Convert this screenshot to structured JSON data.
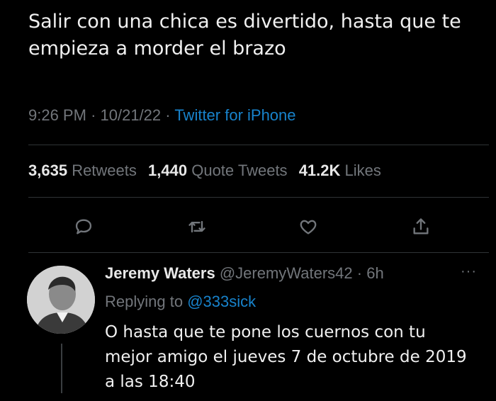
{
  "caption": "Salir con una chica es divertido, hasta que te empieza a morder el brazo",
  "tweet": {
    "time": "9:26 PM",
    "date": "10/21/22",
    "source": "Twitter for iPhone",
    "separator": "·",
    "stats": {
      "retweets_count": "3,635",
      "retweets_label": "Retweets",
      "quotes_count": "1,440",
      "quotes_label": "Quote Tweets",
      "likes_count": "41.2K",
      "likes_label": "Likes"
    }
  },
  "actions": {
    "reply_icon": "reply-icon",
    "retweet_icon": "retweet-icon",
    "like_icon": "heart-icon",
    "share_icon": "share-icon",
    "icon_color": "#72767b"
  },
  "reply": {
    "display_name": "Jeremy Waters",
    "handle": "@JeremyWaters42",
    "age": "6h",
    "more": "···",
    "replying_label": "Replying to",
    "replying_handle": "@333sick",
    "text": "O hasta que te pone los cuernos con tu mejor amigo el jueves 7 de octubre de 2019 a las 18:40"
  },
  "colors": {
    "background": "#000000",
    "text": "#f0f0f0",
    "muted": "#72767b",
    "link": "#1d9bf0",
    "divider": "#2f3336"
  }
}
